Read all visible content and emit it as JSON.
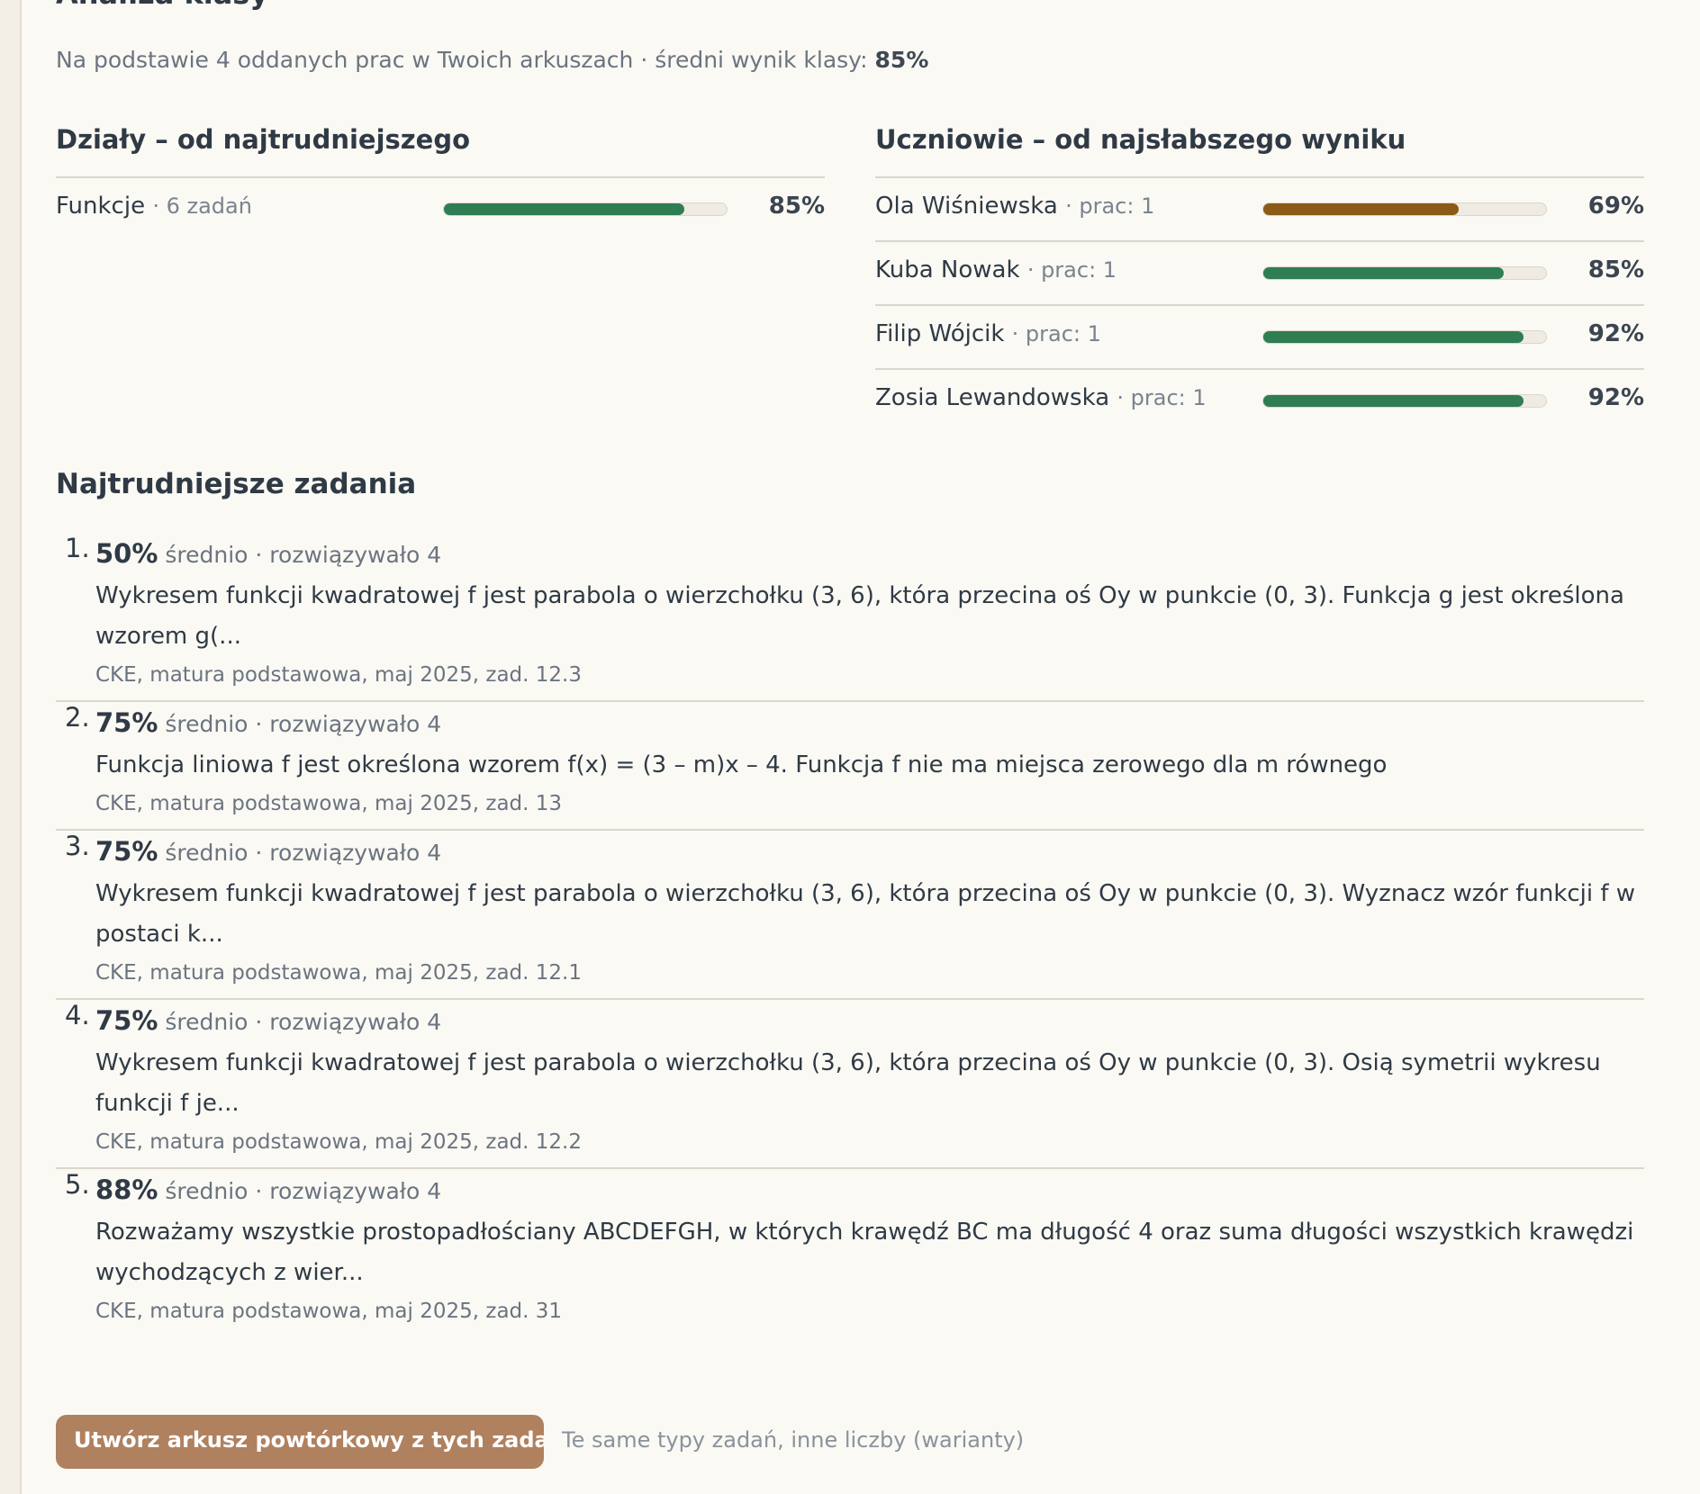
{
  "title": "Analiza klasy",
  "summary": {
    "text": "Na podstawie 4 oddanych prac w Twoich arkuszach · średni wynik klasy:",
    "value": "85%"
  },
  "sections": {
    "left": {
      "title": "Działy – od najtrudniejszego",
      "rows": [
        {
          "name": "Funkcje",
          "sub": "· 6 zadań",
          "pct": "85%",
          "level": 0.85
        }
      ]
    },
    "right": {
      "title": "Uczniowie – od najsłabszego wyniku",
      "rows": [
        {
          "name": "Ola Wiśniewska",
          "sub": "· prac: 1",
          "pct": "69%",
          "level": 0.69
        },
        {
          "name": "Kuba Nowak",
          "sub": "· prac: 1",
          "pct": "85%",
          "level": 0.85
        },
        {
          "name": "Filip Wójcik",
          "sub": "· prac: 1",
          "pct": "92%",
          "level": 0.92
        },
        {
          "name": "Zosia Lewandowska",
          "sub": "· prac: 1",
          "pct": "92%",
          "level": 0.92
        }
      ]
    }
  },
  "hardest": {
    "title": "Najtrudniejsze zadania",
    "tasks": [
      {
        "num": "1.",
        "pct": "50%",
        "meta": "średnio · rozwiązywało 4",
        "text": "Wykresem funkcji kwadratowej f jest parabola o wierzchołku (3, 6), która przecina oś Oy w punkcie (0, 3). Funkcja g jest określona wzorem g(...",
        "src": "CKE, matura podstawowa, maj 2025, zad. 12.3"
      },
      {
        "num": "2.",
        "pct": "75%",
        "meta": "średnio · rozwiązywało 4",
        "text": "Funkcja liniowa f jest określona wzorem f(x) = (3 – m)x – 4. Funkcja f nie ma miejsca zerowego dla m równego",
        "src": "CKE, matura podstawowa, maj 2025, zad. 13"
      },
      {
        "num": "3.",
        "pct": "75%",
        "meta": "średnio · rozwiązywało 4",
        "text": "Wykresem funkcji kwadratowej f jest parabola o wierzchołku (3, 6), która przecina oś Oy w punkcie (0, 3). Wyznacz wzór funkcji f w postaci k...",
        "src": "CKE, matura podstawowa, maj 2025, zad. 12.1"
      },
      {
        "num": "4.",
        "pct": "75%",
        "meta": "średnio · rozwiązywało 4",
        "text": "Wykresem funkcji kwadratowej f jest parabola o wierzchołku (3, 6), która przecina oś Oy w punkcie (0, 3). Osią symetrii wykresu funkcji f je...",
        "src": "CKE, matura podstawowa, maj 2025, zad. 12.2"
      },
      {
        "num": "5.",
        "pct": "88%",
        "meta": "średnio · rozwiązywało 4",
        "text": "Rozważamy wszystkie prostopadłościany ABCDEFGH, w których krawędź BC ma długość 4 oraz suma długości wszystkich krawędzi wychodzących z wier...",
        "src": "CKE, matura podstawowa, maj 2025, zad. 31"
      }
    ]
  },
  "cta": {
    "label": "Utwórz arkusz powtórkowy z tych zadań",
    "note": "Te same typy zadań, inne liczby (warianty)"
  },
  "colors": {
    "good": "#2f7d52",
    "warn": "#8b5a17",
    "button": "#b0815f"
  }
}
